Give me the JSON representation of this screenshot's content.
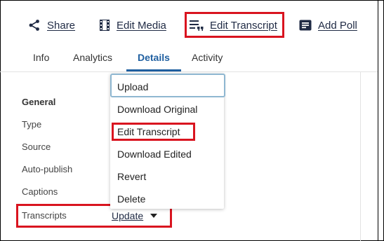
{
  "toolbar": {
    "share_label": "Share",
    "edit_media_label": "Edit Media",
    "edit_transcript_label": "Edit Transcript",
    "add_poll_label": "Add Poll"
  },
  "tabs": [
    {
      "label": "Info"
    },
    {
      "label": "Analytics"
    },
    {
      "label": "Details"
    },
    {
      "label": "Activity"
    }
  ],
  "active_tab": "Details",
  "general": {
    "title": "General",
    "fields": [
      "Type",
      "Source",
      "Auto-publish",
      "Captions",
      "Transcripts"
    ]
  },
  "transcripts_action": {
    "label": "Update"
  },
  "dropdown_menu": {
    "items": [
      "Upload",
      "Download Original",
      "Edit Transcript",
      "Download Edited",
      "Revert",
      "Delete"
    ]
  },
  "colors": {
    "accent": "#1f5fa0",
    "highlight": "#d9141f",
    "focus_outline": "#8fb7d1"
  },
  "icons": [
    "share-icon",
    "film-icon",
    "transcript-icon",
    "poll-icon",
    "caret-down-icon"
  ]
}
